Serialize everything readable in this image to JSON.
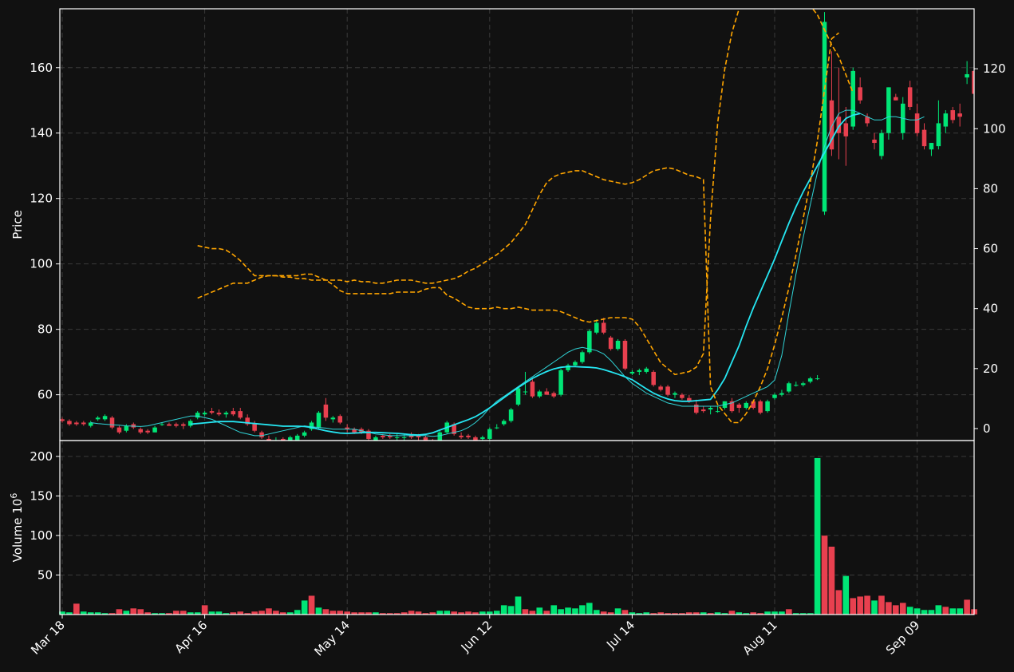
{
  "chart_data": {
    "type": "candlestick",
    "colors": {
      "background": "#111111",
      "up": "#00e676",
      "down": "#e8404f",
      "ma_fast": "#30d5d8",
      "ma_slow": "#25e6f2",
      "bands": "#ffa500",
      "grid": "#3a3a3a",
      "text": "#ffffff"
    },
    "x_ticks": [
      {
        "i": 0,
        "label": "Mar 18"
      },
      {
        "i": 20,
        "label": "Apr 16"
      },
      {
        "i": 40,
        "label": "May 14"
      },
      {
        "i": 60,
        "label": "Jun 12"
      },
      {
        "i": 80,
        "label": "Jul 14"
      },
      {
        "i": 100,
        "label": "Aug 11"
      },
      {
        "i": 120,
        "label": "Sep 09"
      }
    ],
    "price_panel": {
      "ylabel": "Price",
      "ylim": [
        46,
        178
      ],
      "yticks": [
        60,
        80,
        100,
        120,
        140,
        160
      ],
      "secondary_ylim": [
        -4,
        140
      ],
      "secondary_yticks": [
        0,
        20,
        40,
        60,
        80,
        100,
        120
      ]
    },
    "volume_panel": {
      "ylabel": "Volume  10",
      "ylabel_exponent": "6",
      "ylim": [
        0,
        220
      ],
      "yticks": [
        50,
        100,
        150,
        200
      ]
    },
    "candles": [
      [
        52.5,
        53,
        51.5,
        52
      ],
      [
        52,
        52.5,
        50.5,
        51
      ],
      [
        51.5,
        52,
        50.5,
        51
      ],
      [
        51.5,
        52,
        50.5,
        51
      ],
      [
        50.5,
        52,
        50,
        51.5
      ],
      [
        52.5,
        53.5,
        52,
        53
      ],
      [
        52.5,
        54,
        52,
        53.5
      ],
      [
        53,
        53.5,
        49.5,
        50
      ],
      [
        50,
        50.5,
        48,
        48.5
      ],
      [
        49,
        51,
        48.5,
        50.5
      ],
      [
        51,
        51.5,
        49.5,
        50
      ],
      [
        49.5,
        50,
        48,
        48.5
      ],
      [
        49,
        49.5,
        48,
        48.5
      ],
      [
        48.5,
        50.5,
        48.5,
        50
      ],
      [
        51,
        51.5,
        50.5,
        51
      ],
      [
        51,
        51.5,
        50.5,
        50.5
      ],
      [
        51,
        51.5,
        50,
        50.5
      ],
      [
        51,
        51.5,
        49.5,
        50.5
      ],
      [
        50.5,
        52.5,
        50,
        52
      ],
      [
        53,
        55,
        52.5,
        54.5
      ],
      [
        54,
        55,
        53.5,
        54.5
      ],
      [
        55,
        56,
        54,
        54.5
      ],
      [
        54.5,
        55.5,
        53.5,
        54
      ],
      [
        54,
        55,
        53,
        54.5
      ],
      [
        55,
        56,
        53.5,
        54
      ],
      [
        55,
        56,
        52.5,
        53
      ],
      [
        53,
        54,
        50.5,
        51
      ],
      [
        51,
        52,
        48.5,
        49
      ],
      [
        48.5,
        49,
        46.5,
        47
      ],
      [
        46.5,
        47.5,
        45.5,
        46
      ],
      [
        46,
        47,
        45.5,
        46
      ],
      [
        46.5,
        47,
        45,
        45.5
      ],
      [
        45.5,
        47.5,
        45.5,
        47
      ],
      [
        46,
        48,
        45.5,
        47.5
      ],
      [
        47.5,
        49,
        47,
        48.5
      ],
      [
        49.5,
        52,
        49,
        51.5
      ],
      [
        50,
        55,
        49.5,
        54.5
      ],
      [
        57,
        59,
        52,
        53
      ],
      [
        52.5,
        53.5,
        51.5,
        53
      ],
      [
        53.5,
        54,
        51,
        51.5
      ],
      [
        50,
        51,
        48.5,
        49.5
      ],
      [
        49.5,
        50,
        48,
        48.5
      ],
      [
        49.5,
        50,
        48,
        48.5
      ],
      [
        49,
        49.5,
        46,
        46.5
      ],
      [
        46,
        47.5,
        45.5,
        47
      ],
      [
        47.5,
        48,
        46.5,
        47
      ],
      [
        47.5,
        48,
        46.5,
        47
      ],
      [
        47,
        48,
        46,
        47
      ],
      [
        47,
        48,
        46,
        47
      ],
      [
        48,
        48.5,
        46.5,
        47
      ],
      [
        47.5,
        48,
        46,
        47
      ],
      [
        47,
        47.5,
        45.5,
        46
      ],
      [
        45.5,
        46.5,
        44.5,
        45
      ],
      [
        45,
        49,
        44.5,
        48.5
      ],
      [
        48.5,
        52,
        48,
        51.5
      ],
      [
        51,
        51.5,
        47.5,
        48
      ],
      [
        47.5,
        48.5,
        46.5,
        47
      ],
      [
        47.5,
        48,
        46.5,
        47
      ],
      [
        47,
        47.5,
        46,
        46
      ],
      [
        46.5,
        47.5,
        46,
        47
      ],
      [
        46.5,
        50,
        46,
        49.5
      ],
      [
        50,
        51,
        49.5,
        50
      ],
      [
        51,
        52.5,
        50.5,
        52
      ],
      [
        52,
        56,
        51.5,
        55.5
      ],
      [
        57,
        62.5,
        56.5,
        62
      ],
      [
        61,
        67,
        60,
        61
      ],
      [
        64,
        65,
        59,
        59.5
      ],
      [
        59.5,
        61.5,
        59,
        61
      ],
      [
        61,
        62,
        60,
        60
      ],
      [
        60.5,
        61,
        59,
        59.5
      ],
      [
        60,
        68,
        59.5,
        67.5
      ],
      [
        67.5,
        69.5,
        67,
        69
      ],
      [
        69,
        70.5,
        68.5,
        70
      ],
      [
        70,
        73.5,
        69.5,
        73
      ],
      [
        73,
        80,
        72.5,
        79.5
      ],
      [
        79,
        83,
        78.5,
        82
      ],
      [
        82,
        83.5,
        78.5,
        79
      ],
      [
        77.5,
        78,
        73.5,
        74
      ],
      [
        74,
        77,
        73.5,
        76.5
      ],
      [
        76.5,
        77,
        67.5,
        68
      ],
      [
        66.5,
        67.5,
        66,
        67
      ],
      [
        67,
        68,
        66,
        67.5
      ],
      [
        67,
        68.5,
        66.5,
        68
      ],
      [
        67,
        67.5,
        62.5,
        63
      ],
      [
        62.5,
        63,
        61,
        61.5
      ],
      [
        62.5,
        63,
        59.5,
        60
      ],
      [
        60,
        61,
        59,
        60.5
      ],
      [
        60,
        60.5,
        58.5,
        59
      ],
      [
        59,
        60,
        57.5,
        58
      ],
      [
        57,
        58.5,
        54,
        54.5
      ],
      [
        55.5,
        56.5,
        54.5,
        55
      ],
      [
        55.5,
        56.5,
        54,
        56
      ],
      [
        55,
        56.5,
        54.5,
        55
      ],
      [
        56,
        58,
        55.5,
        58
      ],
      [
        58,
        59,
        54.5,
        55
      ],
      [
        57,
        57.5,
        54.5,
        56
      ],
      [
        56,
        58,
        55.5,
        57.5
      ],
      [
        58,
        58.5,
        55.5,
        56
      ],
      [
        58,
        58.5,
        54,
        54.5
      ],
      [
        55,
        58.5,
        54.5,
        58
      ],
      [
        59,
        60.5,
        58.5,
        60
      ],
      [
        60,
        61.5,
        59.5,
        60.5
      ],
      [
        61,
        64,
        60.5,
        63.5
      ],
      [
        63,
        64,
        62.5,
        63
      ],
      [
        63,
        64,
        62.5,
        63.5
      ],
      [
        64,
        65.5,
        63.5,
        65
      ],
      [
        65,
        66,
        64.5,
        65
      ],
      [
        116,
        177,
        115,
        174
      ],
      [
        150,
        165,
        133,
        135
      ],
      [
        145,
        160,
        132,
        140
      ],
      [
        143,
        148,
        130,
        139
      ],
      [
        142,
        160,
        141,
        159
      ],
      [
        154,
        157,
        149,
        150
      ],
      [
        145,
        146,
        142,
        143
      ],
      [
        138,
        140,
        135,
        137
      ],
      [
        133,
        141,
        132,
        140
      ],
      [
        140,
        154,
        138,
        154
      ],
      [
        151,
        152,
        150,
        150
      ],
      [
        140,
        151,
        138,
        149
      ],
      [
        154,
        156,
        147,
        148
      ],
      [
        146,
        149,
        139,
        140
      ],
      [
        141,
        143,
        135,
        136
      ],
      [
        135,
        137,
        133,
        137
      ],
      [
        136,
        150,
        135,
        143
      ],
      [
        142,
        147,
        140,
        146
      ],
      [
        147,
        148,
        143,
        144
      ],
      [
        146,
        149,
        142,
        145
      ],
      [
        157,
        162,
        155,
        158
      ],
      [
        159,
        160,
        151,
        152
      ]
    ],
    "volume": [
      4,
      3,
      14,
      4,
      3,
      3,
      2,
      2,
      7,
      5,
      8,
      7,
      3,
      2,
      2,
      2,
      5,
      5,
      3,
      3,
      12,
      4,
      4,
      2,
      3,
      4,
      2,
      4,
      5,
      8,
      5,
      3,
      3,
      6,
      18,
      24,
      9,
      7,
      5,
      5,
      4,
      3,
      3,
      3,
      3,
      2,
      2,
      2,
      3,
      5,
      4,
      2,
      3,
      5,
      5,
      4,
      3,
      4,
      3,
      4,
      4,
      5,
      12,
      11,
      23,
      7,
      5,
      9,
      5,
      12,
      7,
      9,
      8,
      12,
      15,
      6,
      4,
      3,
      8,
      6,
      3,
      2,
      3,
      2,
      3,
      2,
      2,
      2,
      3,
      3,
      3,
      2,
      3,
      2,
      5,
      3,
      2,
      3,
      2,
      4,
      4,
      4,
      7,
      2,
      2,
      2,
      198,
      100,
      86,
      31,
      49,
      21,
      23,
      24,
      18,
      24,
      16,
      12,
      15,
      10,
      8,
      6,
      6,
      12,
      10,
      8,
      8,
      19,
      7
    ],
    "volume_up": [
      true,
      true,
      false,
      true,
      true,
      true,
      true,
      false,
      false,
      true,
      false,
      false,
      false,
      true,
      true,
      false,
      false,
      false,
      true,
      true,
      false,
      true,
      true,
      true,
      false,
      false,
      false,
      false,
      false,
      false,
      false,
      false,
      true,
      true,
      true,
      false,
      true,
      false,
      false,
      false,
      false,
      false,
      false,
      false,
      true,
      false,
      false,
      false,
      false,
      false,
      false,
      false,
      false,
      true,
      true,
      false,
      false,
      false,
      false,
      true,
      true,
      true,
      true,
      true,
      true,
      false,
      false,
      true,
      false,
      true,
      true,
      true,
      true,
      true,
      true,
      true,
      false,
      false,
      true,
      false,
      true,
      true,
      true,
      false,
      false,
      false,
      false,
      false,
      false,
      false,
      true,
      false,
      true,
      true,
      false,
      true,
      true,
      false,
      false,
      true,
      true,
      true,
      false,
      true,
      true,
      true,
      true,
      false,
      false,
      false,
      true,
      false,
      false,
      false,
      true,
      false,
      false,
      false,
      false,
      true,
      true,
      true,
      true,
      true,
      false,
      true,
      true,
      false
    ],
    "ma_fast_start": 4,
    "ma_fast": [
      51.5,
      51.2,
      51.0,
      50.8,
      50.7,
      50.5,
      50.4,
      50.3,
      50.5,
      51.0,
      51.5,
      52.0,
      52.5,
      53.0,
      53.5,
      53.5,
      53.0,
      52.5,
      51.5,
      50.5,
      49.5,
      48.5,
      48.0,
      47.5,
      47.5,
      48.0,
      48.5,
      49.0,
      49.5,
      50.0,
      50.5,
      50.2,
      50.0,
      49.8,
      49.5,
      49.5,
      49.5,
      49.5,
      49.0,
      48.5,
      48.0,
      47.8,
      47.5,
      47.5,
      47.5,
      47.5,
      47.5,
      47.5,
      47.3,
      47.5,
      48.0,
      48.5,
      49.0,
      50.0,
      51.5,
      53.5,
      56.0,
      58.0,
      59.5,
      61.0,
      62.5,
      64.0,
      65.5,
      67.0,
      68.5,
      70.0,
      71.5,
      73.0,
      74.0,
      74.5,
      74.0,
      73.5,
      72.5,
      70.5,
      68.0,
      65.5,
      63.5,
      62.0,
      60.5,
      59.5,
      58.5,
      57.5,
      57.0,
      56.5,
      56.5,
      56.5,
      56.5,
      56.5,
      56.5,
      57.0,
      57.5,
      58.5,
      59.5,
      60.5,
      61.5,
      62.5,
      64.5,
      72.0,
      85.0,
      97.0,
      108.0,
      118.0,
      128.0,
      136.0,
      142.0,
      146.0,
      147.0,
      147.0,
      146.0,
      145.0,
      144.0,
      144.0,
      145.0,
      145.0,
      144.5,
      144.0,
      144.0,
      145.0
    ],
    "ma_slow_start": 18,
    "ma_slow": [
      51.0,
      51.2,
      51.4,
      51.6,
      51.8,
      51.8,
      51.8,
      51.6,
      51.4,
      51.2,
      51.0,
      50.8,
      50.6,
      50.4,
      50.4,
      50.4,
      50.3,
      50.0,
      49.5,
      49.0,
      48.6,
      48.3,
      48.2,
      48.3,
      48.4,
      48.5,
      48.5,
      48.4,
      48.3,
      48.2,
      48.0,
      47.8,
      47.7,
      47.9,
      48.4,
      49.2,
      50.0,
      50.8,
      51.6,
      52.4,
      53.3,
      54.6,
      56.0,
      57.5,
      59.1,
      60.7,
      62.2,
      63.6,
      65.0,
      66.1,
      67.1,
      67.9,
      68.4,
      68.6,
      68.6,
      68.5,
      68.4,
      68.2,
      67.7,
      67.0,
      66.3,
      65.5,
      64.6,
      63.2,
      61.8,
      60.5,
      59.5,
      58.7,
      58.2,
      58.0,
      58.0,
      58.2,
      58.4,
      58.6,
      61.5,
      65.0,
      70.0,
      75.0,
      81.0,
      86.5,
      91.5,
      96.5,
      101.5,
      107.0,
      112.5,
      117.5,
      122.0,
      126.0,
      130.0,
      134.0,
      138.0,
      142.0,
      144.5,
      145.5,
      146.0
    ],
    "band_start": 19,
    "band_upper": [
      43.5,
      44.5,
      45.5,
      46.5,
      47.5,
      48.5,
      48.5,
      48.5,
      49.5,
      50.5,
      51.0,
      51.0,
      51.0,
      51.0,
      51.0,
      51.5,
      51.5,
      50.5,
      49.5,
      48.0,
      46.0,
      45.0,
      45.0,
      45.0,
      45.0,
      45.0,
      45.0,
      45.0,
      45.5,
      45.5,
      45.5,
      45.5,
      46.5,
      47.0,
      47.0,
      44.5,
      43.5,
      42.0,
      40.5,
      40.0,
      40.0,
      40.0,
      40.5,
      40.0,
      40.0,
      40.5,
      40.0,
      39.5,
      39.5,
      39.5,
      39.5,
      39.0,
      38.0,
      37.0,
      36.0,
      35.5,
      36.0,
      36.5,
      37.0,
      37.0,
      37.0,
      36.5,
      34.0,
      30.0,
      26.0,
      22.0,
      20.0,
      18.0,
      18.5,
      19.0,
      20.5,
      25.0,
      70.0,
      102.0,
      120.0,
      132.0,
      140.0,
      145.0,
      149.0,
      151.0,
      152.0,
      152.0,
      150.0,
      148.0,
      145.0,
      143.0,
      141.0,
      138.0,
      133.0,
      128.0,
      124.0,
      118.0,
      112.0
    ],
    "band_lower": [
      61.0,
      60.5,
      60.0,
      60.0,
      59.5,
      58.0,
      56.0,
      53.5,
      51.0,
      51.0,
      51.0,
      51.0,
      50.5,
      50.5,
      50.0,
      50.0,
      49.5,
      49.5,
      49.5,
      49.5,
      49.5,
      49.0,
      49.5,
      49.0,
      49.0,
      48.5,
      48.5,
      49.0,
      49.5,
      49.5,
      49.5,
      49.0,
      48.5,
      48.5,
      49.0,
      49.5,
      50.0,
      51.0,
      52.5,
      53.5,
      55.0,
      56.5,
      58.0,
      60.0,
      62.0,
      65.0,
      68.0,
      73.0,
      78.0,
      82.0,
      84.0,
      85.0,
      85.5,
      86.0,
      86.0,
      85.0,
      84.0,
      83.0,
      82.5,
      82.0,
      81.5,
      82.0,
      83.0,
      84.5,
      86.0,
      86.5,
      87.0,
      86.5,
      85.5,
      84.5,
      84.0,
      83.0,
      14.0,
      8.0,
      5.0,
      2.0,
      2.0,
      5.0,
      9.0,
      14.0,
      20.0,
      28.0,
      37.0,
      47.0,
      58.0,
      70.0,
      82.0,
      96.0,
      113.0,
      130.0,
      132.0
    ]
  }
}
